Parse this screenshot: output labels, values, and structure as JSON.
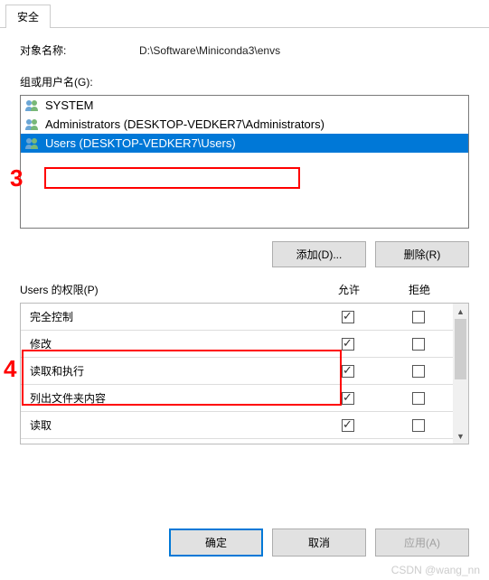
{
  "tabs": {
    "security": "安全"
  },
  "objectName": {
    "label": "对象名称:",
    "value": "D:\\Software\\Miniconda3\\envs"
  },
  "groupList": {
    "label": "组或用户名(G):",
    "items": [
      {
        "name": "SYSTEM"
      },
      {
        "name": "Administrators (DESKTOP-VEDKER7\\Administrators)"
      },
      {
        "name": "Users (DESKTOP-VEDKER7\\Users)"
      }
    ]
  },
  "buttons": {
    "add": "添加(D)...",
    "remove": "删除(R)",
    "ok": "确定",
    "cancel": "取消",
    "apply": "应用(A)"
  },
  "permissions": {
    "header": {
      "label": "Users 的权限(P)",
      "allow": "允许",
      "deny": "拒绝"
    },
    "rows": [
      {
        "name": "完全控制",
        "allow": true,
        "deny": false
      },
      {
        "name": "修改",
        "allow": true,
        "deny": false
      },
      {
        "name": "读取和执行",
        "allow": true,
        "deny": false
      },
      {
        "name": "列出文件夹内容",
        "allow": true,
        "deny": false
      },
      {
        "name": "读取",
        "allow": true,
        "deny": false
      }
    ]
  },
  "annotations": {
    "step3": "3",
    "step4": "4"
  },
  "watermark": "CSDN @wang_nn"
}
